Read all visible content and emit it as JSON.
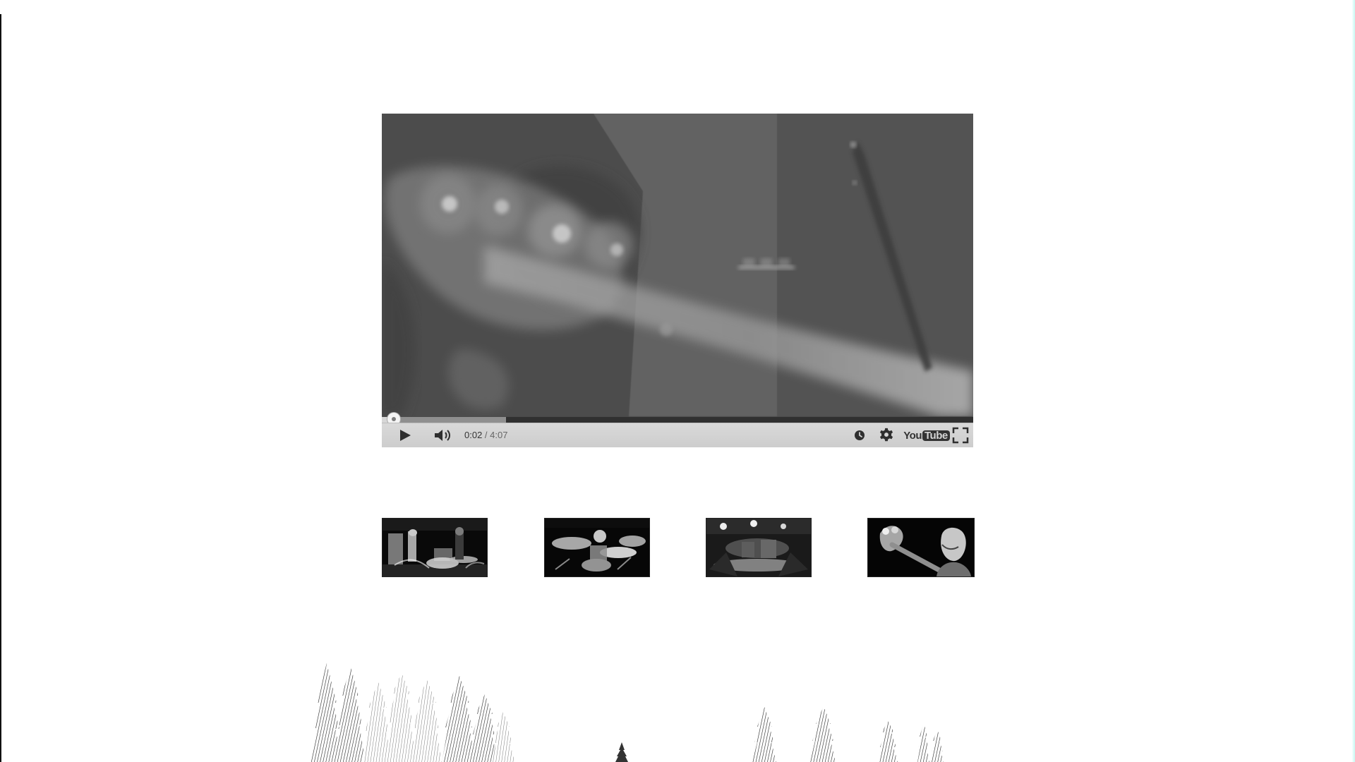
{
  "player": {
    "time": {
      "current": "0:02",
      "separator": " / ",
      "total": "4:07"
    },
    "progress": {
      "played_fraction": 0.02,
      "loaded_fraction": 0.21
    },
    "youtube_logo": {
      "you": "You",
      "tube": "Tube"
    },
    "icons": {
      "play": "play-icon",
      "volume": "volume-icon",
      "watch_later": "watch-later-icon",
      "settings": "settings-icon",
      "fullscreen": "fullscreen-icon"
    }
  },
  "thumbnails": [
    {
      "name": "band-stage-thumbnail"
    },
    {
      "name": "drummer-thumbnail"
    },
    {
      "name": "live-stage-thumbnail"
    },
    {
      "name": "bassist-thumbnail"
    }
  ],
  "colors": {
    "page_background": "#ffffff",
    "player_background": "#4b4b4b",
    "controls_background": "#d4d4d4"
  }
}
